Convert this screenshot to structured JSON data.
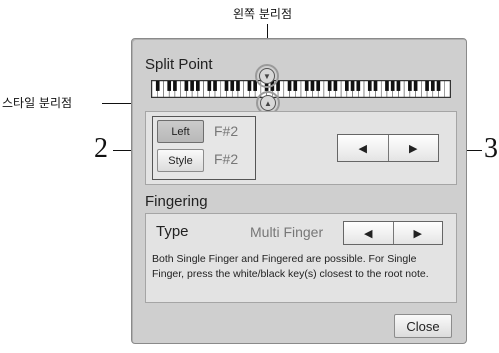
{
  "callouts": {
    "left_split_point": "왼쪽 분리점",
    "style_split_point": "스타일 분리점",
    "num_2": "2",
    "num_3": "3"
  },
  "dialog": {
    "split_point_title": "Split Point",
    "left_button": "Left",
    "left_value": "F#2",
    "style_button": "Style",
    "style_value": "F#2",
    "arrow_left": "◀",
    "arrow_right": "▶",
    "fingering_title": "Fingering",
    "type_label": "Type",
    "type_value": "Multi Finger",
    "description": "Both Single Finger and Fingered are possible. For Single Finger, press the white/black key(s) closest to the root note.",
    "close_button": "Close"
  },
  "colors": {
    "dialog_bg": "#cfcfcf",
    "panel_bg": "#e3e3e3"
  }
}
